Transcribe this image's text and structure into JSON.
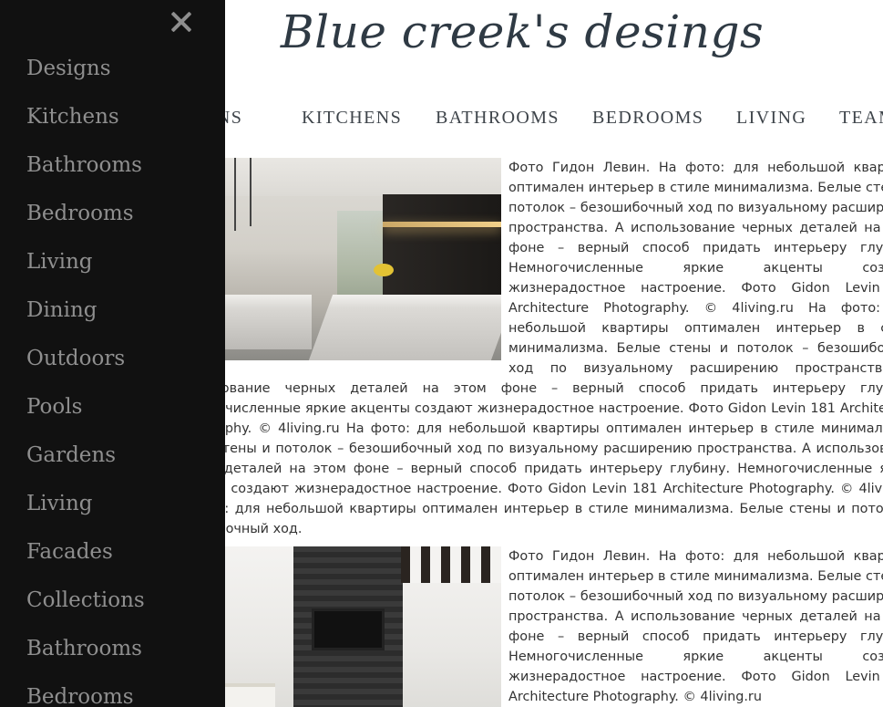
{
  "site": {
    "title": "Blue creek's desings"
  },
  "top_nav": {
    "items": [
      "DESIGNS",
      "KITCHENS",
      "BATHROOMS",
      "BEDROOMS",
      "LIVING",
      "TEAM"
    ]
  },
  "articles": [
    {
      "image_alt": "Minimalist kitchen photo",
      "text": "Фото Гидон Левин. На фото: для небольшой квартиры оптимален интерьер в стиле минимализма. Белые стены и потолок – безошибочный ход по визуальному расширению пространства. А использование черных деталей на этом фоне – верный способ придать интерьеру глубину. Немногочисленные яркие акценты создают жизнерадостное настроение. Фото Gidon Levin 181 Architecture Photography. © 4living.ru На фото: для небольшой квартиры оптимален интерьер в стиле минимализма. Белые стены и потолок – безошибочный ход по визуальному расширению пространства. А использование черных деталей на этом фоне – верный способ придать интерьеру глубину. Немногочисленные яркие акценты создают жизнерадостное настроение. Фото Gidon Levin 181 Architecture Photography. © 4living.ru На фото: для небольшой квартиры оптимален интерьер в стиле минимализма. Белые стены и потолок – безошибочный ход по визуальному расширению пространства. А использование черных деталей на этом фоне – верный способ придать интерьеру глубину. Немногочисленные яркие акценты создают жизнерадостное настроение. Фото Gidon Levin 181 Architecture Photography. © 4living.ru На фото: для небольшой квартиры оптимален интерьер в стиле минимализма. Белые стены и потолок – безошибочный ход."
    },
    {
      "image_alt": "Living room photo",
      "text": "Фото Гидон Левин. На фото: для небольшой квартиры оптимален интерьер в стиле минимализма. Белые стены и потолок – безошибочный ход по визуальному расширению пространства. А использование черных деталей на этом фоне – верный способ придать интерьеру глубину. Немногочисленные яркие акценты создают жизнерадостное настроение. Фото Gidon Levin 181 Architecture Photography. © 4living.ru"
    }
  ],
  "drawer": {
    "close_label": "×",
    "items": [
      "Designs",
      "Kitchens",
      "Bathrooms",
      "Bedrooms",
      "Living",
      "Dining",
      "Outdoors",
      "Pools",
      "Gardens",
      "Living",
      "Facades",
      "Collections",
      "Bathrooms",
      "Bedrooms"
    ]
  }
}
